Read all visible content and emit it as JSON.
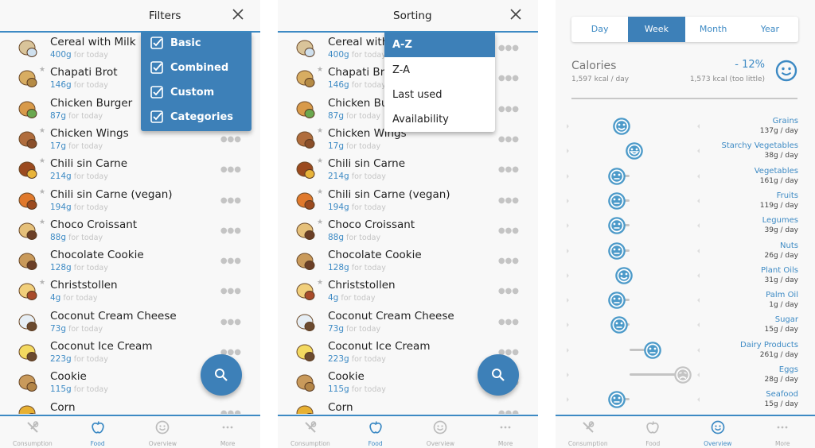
{
  "colors": {
    "accent": "#3d8ac4",
    "menu_bg": "#3d80b8",
    "muted": "#c4c4c4"
  },
  "food_list": [
    {
      "name": "Cereal with Milk",
      "amount": "400g",
      "starred": false,
      "icon": "cereal-milk-icon"
    },
    {
      "name": "Chapati Brot",
      "amount": "146g",
      "starred": true,
      "icon": "chapati-icon"
    },
    {
      "name": "Chicken Burger",
      "amount": "87g",
      "starred": false,
      "icon": "burger-icon"
    },
    {
      "name": "Chicken Wings",
      "amount": "17g",
      "starred": true,
      "icon": "chicken-wing-icon"
    },
    {
      "name": "Chili sin Carne",
      "amount": "214g",
      "starred": true,
      "icon": "chili-icon"
    },
    {
      "name": "Chili sin Carne (vegan)",
      "amount": "194g",
      "starred": true,
      "icon": "chili-vegan-icon"
    },
    {
      "name": "Choco Croissant",
      "amount": "88g",
      "starred": true,
      "icon": "croissant-icon"
    },
    {
      "name": "Chocolate Cookie",
      "amount": "128g",
      "starred": false,
      "icon": "chocolate-cookie-icon"
    },
    {
      "name": "Christstollen",
      "amount": "4g",
      "starred": true,
      "icon": "stollen-icon"
    },
    {
      "name": "Coconut Cream Cheese",
      "amount": "73g",
      "starred": false,
      "icon": "coconut-cheese-icon"
    },
    {
      "name": "Coconut Ice Cream",
      "amount": "223g",
      "starred": false,
      "icon": "coconut-icecream-icon"
    },
    {
      "name": "Cookie",
      "amount": "115g",
      "starred": false,
      "icon": "cookie-icon"
    },
    {
      "name": "Corn",
      "amount": "",
      "starred": false,
      "icon": "corn-icon"
    }
  ],
  "for_today_label": "for today",
  "panel1": {
    "title": "Filters",
    "filters": [
      {
        "label": "Basic",
        "checked": true
      },
      {
        "label": "Combined",
        "checked": true
      },
      {
        "label": "Custom",
        "checked": true
      },
      {
        "label": "Categories",
        "checked": true
      }
    ]
  },
  "panel2": {
    "title": "Sorting",
    "options": [
      {
        "label": "A-Z",
        "selected": true
      },
      {
        "label": "Z-A",
        "selected": false
      },
      {
        "label": "Last used",
        "selected": false
      },
      {
        "label": "Availability",
        "selected": false
      }
    ]
  },
  "panel3": {
    "periods": [
      {
        "label": "Day",
        "active": false
      },
      {
        "label": "Week",
        "active": true
      },
      {
        "label": "Month",
        "active": false
      },
      {
        "label": "Year",
        "active": false
      }
    ],
    "calories": {
      "title": "Calories",
      "consumed": "1,597 kcal / day",
      "percent": "- 12%",
      "target_note": "1,573 kcal (too little)"
    },
    "categories": [
      {
        "name": "Grains",
        "amount": "137g / day",
        "level": 0.41,
        "mood": "happy",
        "bar_from": 0.41,
        "bar_to": 0.45,
        "gray": false
      },
      {
        "name": "Starchy Vegetables",
        "amount": "38g / day",
        "level": 0.51,
        "mood": "very-happy",
        "bar_from": 0.51,
        "bar_to": 0.51,
        "gray": false
      },
      {
        "name": "Vegetables",
        "amount": "161g / day",
        "level": 0.37,
        "mood": "neutral",
        "bar_from": 0.37,
        "bar_to": 0.47,
        "gray": false
      },
      {
        "name": "Fruits",
        "amount": "119g / day",
        "level": 0.37,
        "mood": "neutral",
        "bar_from": 0.37,
        "bar_to": 0.47,
        "gray": false
      },
      {
        "name": "Legumes",
        "amount": "39g / day",
        "level": 0.37,
        "mood": "neutral",
        "bar_from": 0.37,
        "bar_to": 0.47,
        "gray": false
      },
      {
        "name": "Nuts",
        "amount": "26g / day",
        "level": 0.37,
        "mood": "neutral",
        "bar_from": 0.37,
        "bar_to": 0.47,
        "gray": false
      },
      {
        "name": "Plant Oils",
        "amount": "31g / day",
        "level": 0.43,
        "mood": "happy",
        "bar_from": 0.43,
        "bar_to": 0.43,
        "gray": false
      },
      {
        "name": "Palm Oil",
        "amount": "1g / day",
        "level": 0.37,
        "mood": "neutral",
        "bar_from": 0.37,
        "bar_to": 0.47,
        "gray": false
      },
      {
        "name": "Sugar",
        "amount": "15g / day",
        "level": 0.39,
        "mood": "neutral",
        "bar_from": 0.39,
        "bar_to": 0.47,
        "gray": false
      },
      {
        "name": "Dairy Products",
        "amount": "261g / day",
        "level": 0.65,
        "mood": "neutral",
        "bar_from": 0.47,
        "bar_to": 0.65,
        "gray": false
      },
      {
        "name": "Eggs",
        "amount": "28g / day",
        "level": 0.89,
        "mood": "sad",
        "bar_from": 0.47,
        "bar_to": 0.89,
        "gray": true
      },
      {
        "name": "Seafood",
        "amount": "15g / day",
        "level": 0.37,
        "mood": "neutral",
        "bar_from": 0.37,
        "bar_to": 0.47,
        "gray": false
      }
    ]
  },
  "nav": [
    {
      "label": "Consumption",
      "icon": "fork-spoon-icon"
    },
    {
      "label": "Food",
      "icon": "apple-icon"
    },
    {
      "label": "Overview",
      "icon": "smiley-icon"
    },
    {
      "label": "More",
      "icon": "more-dots-icon"
    }
  ],
  "nav_active": {
    "p1": 1,
    "p2": 1,
    "p3": 2
  }
}
